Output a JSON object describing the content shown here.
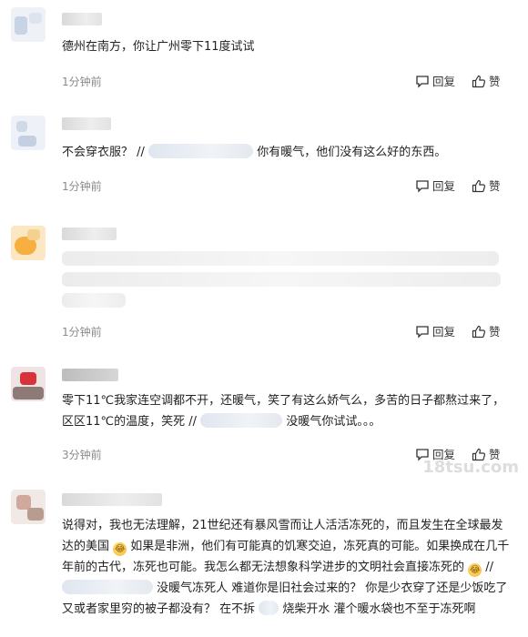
{
  "actions": {
    "reply_label": "回复",
    "like_label": "赞"
  },
  "comments": [
    {
      "text": "德州在南方，你让广州零下11度试试",
      "time": "1分钟前"
    },
    {
      "text_a": "不会穿衣服？ //",
      "text_b": "你有暖气，他们没有这么好的东西。",
      "time": "1分钟前"
    },
    {
      "time": "1分钟前"
    },
    {
      "text_a": "零下11℃我家连空调都不开，还暖气，笑了有这么娇气么，多苦的日子都熬过来了，区区11℃的温度，笑死 //",
      "text_b": "没暖气你试试。。。",
      "time": "3分钟前"
    },
    {
      "text_a": "说得对，我也无法理解，21世纪还有暴风雪而让人活活冻死的，而且发生在全球最发达的美国",
      "text_b": "如果是非洲，他们有可能真的饥寒交迫，冻死真的可能。如果换成在几千年前的古代，冻死也可能。我怎么都无法想象科学进步的文明社会直接冻死的",
      "text_c": "//",
      "text_d": "没暖气冻死人 难道你是旧社会过来的？ 你是少衣穿了还是少饭吃了 又或者家里穷的被子都没有？ 在不拆",
      "text_e": "烧柴开水 灌个暖水袋也不至于冻死啊"
    }
  ],
  "watermark": "18tsu.com"
}
